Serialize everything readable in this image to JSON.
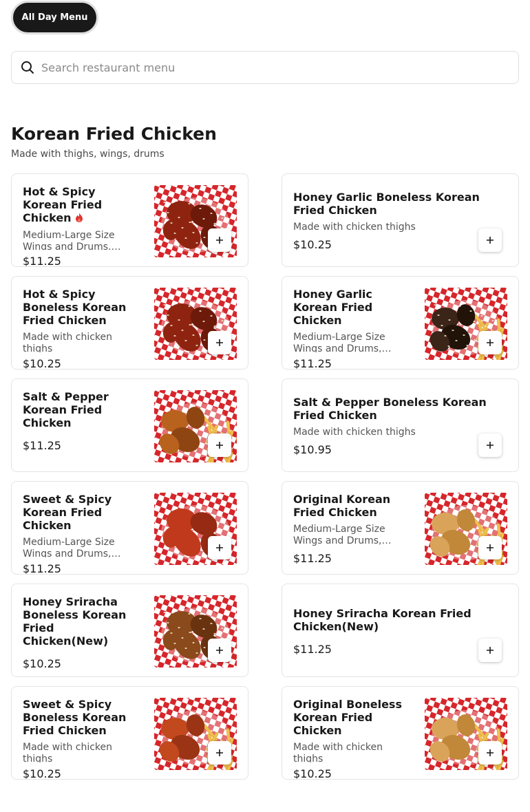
{
  "menu_selector": {
    "label": "All Day Menu"
  },
  "search": {
    "placeholder": "Search restaurant menu",
    "icon": "search-icon"
  },
  "section": {
    "title": "Korean Fried Chicken",
    "description": "Made with thighs, wings, drums"
  },
  "items": [
    {
      "title": "Hot & Spicy Korean Fried Chicken",
      "spicy": true,
      "description": "Medium-Large Size Wings and Drums, Marinated and fried",
      "price": "$11.25",
      "has_image": true,
      "image": "spicy-chicken-basket"
    },
    {
      "title": "Honey Garlic Boneless Korean Fried Chicken",
      "spicy": false,
      "description": "Made with chicken thighs",
      "price": "$10.25",
      "has_image": false
    },
    {
      "title": "Hot & Spicy Boneless Korean Fried Chicken",
      "spicy": false,
      "description": "Made with chicken thighs",
      "price": "$10.25",
      "has_image": true,
      "image": "spicy-chicken-basket"
    },
    {
      "title": "Honey Garlic Korean Fried Chicken",
      "spicy": false,
      "description": "Medium-Large Size Wings and Drums, Marinated and fried",
      "price": "$11.25",
      "has_image": true,
      "image": "dark-chicken-fries"
    },
    {
      "title": "Salt & Pepper Korean Fried Chicken",
      "spicy": false,
      "description": "",
      "price": "$11.25",
      "has_image": true,
      "image": "golden-chicken-fries"
    },
    {
      "title": "Salt & Pepper Boneless Korean Fried Chicken",
      "spicy": false,
      "description": "Made with chicken thighs",
      "price": "$10.95",
      "has_image": false
    },
    {
      "title": "Sweet & Spicy Korean Fried Chicken",
      "spicy": false,
      "description": "Medium-Large Size Wings and Drums, Marinated and fried",
      "price": "$11.25",
      "has_image": true,
      "image": "red-chicken-basket"
    },
    {
      "title": "Original Korean Fried Chicken",
      "spicy": false,
      "description": "Medium-Large Size Wings and Drums, Marinated and fried",
      "price": "$11.25",
      "has_image": true,
      "image": "plain-chicken-fries"
    },
    {
      "title": "Honey Sriracha Boneless Korean Fried Chicken(New)",
      "spicy": false,
      "description": "",
      "price": "$10.25",
      "has_image": true,
      "image": "sesame-chicken-basket"
    },
    {
      "title": "Honey Sriracha Korean Fried Chicken(New)",
      "spicy": false,
      "description": "",
      "price": "$11.25",
      "has_image": false
    },
    {
      "title": "Sweet & Spicy Boneless Korean Fried Chicken",
      "spicy": false,
      "description": "Made with chicken thighs",
      "price": "$10.25",
      "has_image": true,
      "image": "red-chicken-fries"
    },
    {
      "title": "Original Boneless Korean Fried Chicken",
      "spicy": false,
      "description": "Made with chicken thighs",
      "price": "$10.25",
      "has_image": true,
      "image": "plain-chicken-fries"
    }
  ],
  "colors": {
    "accent": "#191919",
    "spicy_icon": "#e0342f",
    "checker_red": "#d6262b"
  }
}
